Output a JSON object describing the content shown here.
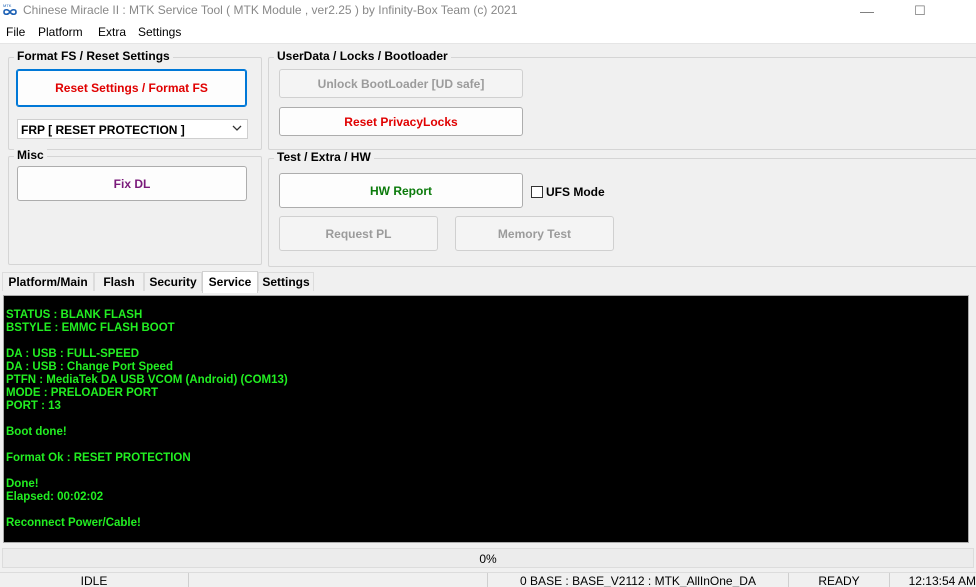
{
  "window": {
    "title": "Chinese Miracle II : MTK Service Tool ( MTK Module , ver2.25  ) by Infinity-Box Team (c) 2021",
    "logo_icon": "infinity-logo-icon",
    "minimize_glyph": "—",
    "maximize_glyph": "☐"
  },
  "menu": {
    "items": [
      "File",
      "Platform",
      "Extra",
      "Settings"
    ]
  },
  "format_group": {
    "title": "Format FS / Reset Settings",
    "reset_button": "Reset Settings / Format FS",
    "mode_select": "FRP [ RESET PROTECTION ]"
  },
  "userdata_group": {
    "title": "UserData /  Locks  / Bootloader",
    "unlock_button": "Unlock BootLoader [UD safe]",
    "privacy_button": "Reset PrivacyLocks"
  },
  "misc_group": {
    "title": "Misc",
    "fixdl_button": "Fix DL"
  },
  "test_group": {
    "title": "Test / Extra / HW",
    "hwreport_button": "HW Report",
    "ufs_label": "UFS Mode",
    "requestpl_button": "Request PL",
    "memtest_button": "Memory Test"
  },
  "tabs": [
    {
      "label": "Platform/Main"
    },
    {
      "label": "Flash"
    },
    {
      "label": "Security"
    },
    {
      "label": "Service"
    },
    {
      "label": "Settings"
    }
  ],
  "log": [
    " STATUS : BLANK FLASH",
    " BSTYLE : EMMC FLASH BOOT",
    "",
    "DA : USB : FULL-SPEED",
    "DA : USB : Change Port Speed",
    "PTFN : MediaTek DA USB VCOM (Android) (COM13)",
    "MODE : PRELOADER PORT",
    "PORT : 13",
    "",
    "Boot done!",
    "",
    "Format Ok : RESET PROTECTION",
    "",
    "Done!",
    "Elapsed: 00:02:02",
    "",
    "Reconnect Power/Cable!"
  ],
  "progress": {
    "text": "0%",
    "value": 0
  },
  "status": {
    "state": "IDLE",
    "base": "0  BASE : BASE_V2112 : MTK_AllInOne_DA",
    "ready": "READY",
    "time": "12:13:54 AM"
  },
  "colors": {
    "console_bg": "#000000",
    "console_text": "#22ee22",
    "danger_text": "#e00000",
    "ok_text": "#0a7a0a",
    "misc_text": "#7a1a7a",
    "focus_border": "#0078d7"
  }
}
